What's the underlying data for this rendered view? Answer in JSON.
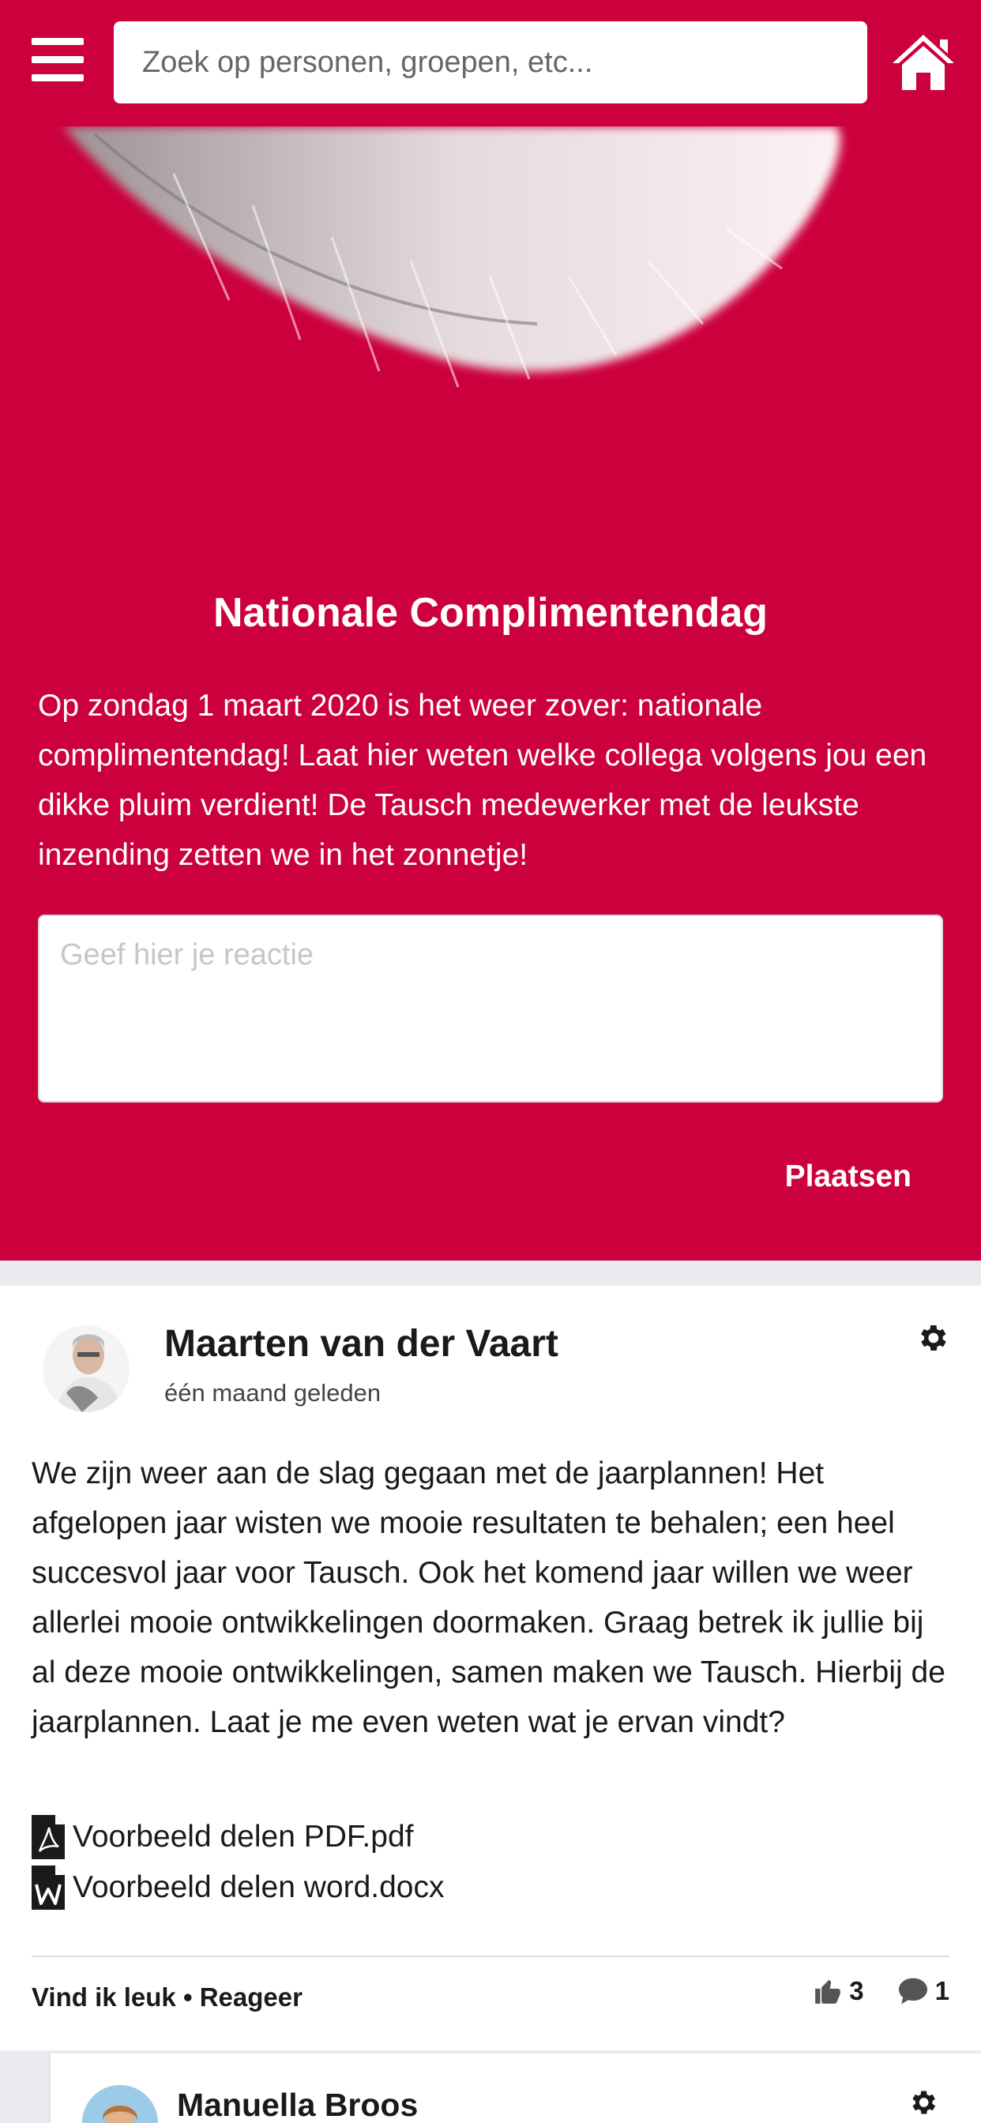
{
  "header": {
    "search_placeholder": "Zoek op personen, groepen, etc...",
    "menu_icon": "hamburger-icon",
    "home_icon": "home-icon"
  },
  "hero": {
    "title": "Nationale Complimentendag",
    "text": "Op zondag 1 maart 2020 is het weer zover: nationale complimentendag! Laat hier weten welke collega volgens jou een dikke pluim verdient! De Tausch medewerker met de leukste inzending zetten we in het zonnetje!",
    "reply_placeholder": "Geef hier je reactie",
    "post_button": "Plaatsen",
    "background_color": "#cc003d"
  },
  "post": {
    "author": "Maarten van der Vaart",
    "time": "één maand geleden",
    "text": "We zijn weer aan de slag gegaan met de jaarplannen! Het afgelopen jaar wisten we mooie resultaten te behalen; een heel succesvol jaar voor Tausch. Ook het komend jaar willen we weer allerlei mooie ontwikkelingen doormaken. Graag betrek ik jullie bij al deze mooie ontwikkelingen, samen maken we Tausch. Hierbij de jaarplannen. Laat je me even weten wat je ervan vindt?",
    "attachments": [
      {
        "name": "Voorbeeld delen PDF.pdf",
        "icon": "pdf-file-icon"
      },
      {
        "name": "Voorbeeld delen word.docx",
        "icon": "word-file-icon"
      }
    ],
    "like_label": "Vind ik leuk",
    "separator": "•",
    "reply_label": "Reageer",
    "like_count": "3",
    "comment_count": "1"
  },
  "comment": {
    "author": "Manuella Broos"
  }
}
